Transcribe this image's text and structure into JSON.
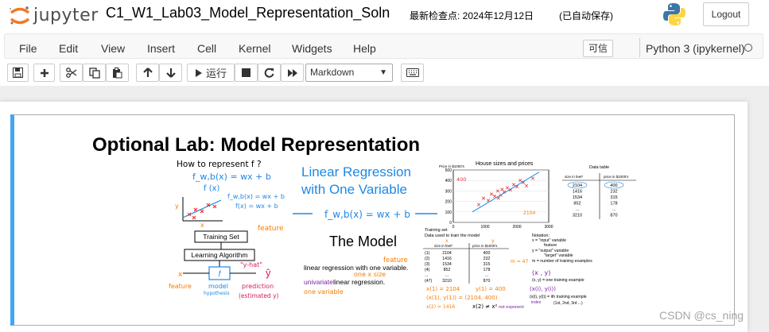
{
  "header": {
    "logo_text": "jupyter",
    "notebook_title": "C1_W1_Lab03_Model_Representation_Soln",
    "checkpoint": "最新检查点: 2024年12月12日",
    "autosave": "(已自动保存)",
    "logout_label": "Logout"
  },
  "menu": {
    "items": [
      "File",
      "Edit",
      "View",
      "Insert",
      "Cell",
      "Kernel",
      "Widgets",
      "Help"
    ],
    "trusted_label": "可信",
    "kernel_name": "Python 3 (ipykernel)"
  },
  "toolbar": {
    "run_label": "运行",
    "cell_type": "Markdown",
    "icons": [
      "save-icon",
      "plus-icon",
      "cut-icon",
      "copy-icon",
      "paste-icon",
      "arrow-up-icon",
      "arrow-down-icon",
      "play-icon",
      "stop-icon",
      "restart-icon",
      "fast-forward-icon",
      "keyboard-icon"
    ]
  },
  "cell": {
    "heading": "Optional Lab: Model Representation"
  },
  "figure": {
    "how_to_represent": "How to represent f ?",
    "f_eq1": "f_w,b(x) = wx + b",
    "f_of_x": "f (x)",
    "f_eq2": "f_w,b(x) = wx + b",
    "f_eq3": "f(x) = wx + b",
    "y_axis": "y",
    "x_axis": "x",
    "feature_label1": "feature",
    "training_set": "Training Set",
    "learning_algorithm": "Learning Algorithm",
    "f_box": "f",
    "y_hat_note": "\"y-hat\"",
    "y_hat": "ŷ",
    "x_in": "x",
    "feature_label2": "feature",
    "model_label": "model",
    "hypothesis_label": "hypothesis",
    "prediction_label": "prediction",
    "estimated_y": "(estimated y)",
    "lr_title_line1": "Linear Regression",
    "lr_title_line2": "with One Variable",
    "lr_eq": "f_w,b(x) = wx + b",
    "the_model": "The Model",
    "feature_note": "feature",
    "lr_desc_1": "linear regression with one variable.",
    "one_x_size": "one x  size",
    "univariate": "univariate",
    "univariate_rest": " linear regression.",
    "one_variable": "one variable",
    "chart_title": "House sizes and prices",
    "chart_ylabel": "Price in $1000's",
    "chart_yticks": [
      "500",
      "400",
      "300",
      "200",
      "100",
      "0"
    ],
    "chart_xticks": [
      "0",
      "1000",
      "2000",
      "3000"
    ],
    "chart_anno_400": "400",
    "chart_anno_2104": "2104",
    "data_table_title": "Data table",
    "dt_col1": "size in feet²",
    "dt_col2": "price in $1000's",
    "dt_sizes": [
      "2104",
      "1416",
      "1534",
      "852",
      "...",
      "3210"
    ],
    "dt_prices": [
      "400",
      "232",
      "315",
      "178",
      "...",
      "870"
    ],
    "ts_title": "Training set",
    "ts_subtitle": "Data used to train the model",
    "ts_x": "x",
    "ts_y": "y",
    "ts_col1": "size in feet²",
    "ts_col2": "price in $1000's",
    "ts_idx": [
      "(1)",
      "(2)",
      "(3)",
      "(4)",
      "...",
      "(47)"
    ],
    "ts_sizes": [
      "2104",
      "1416",
      "1534",
      "852",
      "...",
      "3210"
    ],
    "ts_prices": [
      "400",
      "232",
      "315",
      "178",
      "...",
      "870"
    ],
    "ts_m": "m = 47",
    "ts_x1": "x(1) = 2104",
    "ts_y1": "y(1) = 400",
    "ts_pair": "(x(1), y(1)) = (2104, 400)",
    "ts_x2": "x(2) = 1416",
    "ts_x2note": "x(2) ≠ x²",
    "ts_not_exponent": "not exponent",
    "notation_title": "Notation:",
    "notation_1": "x = \"input\" variable",
    "notation_1b": "feature",
    "notation_2": "y = \"output\" variable",
    "notation_2b": "\"target\" variable",
    "notation_3": "m = number of training examples",
    "notation_xy": "(x , y)",
    "notation_4": "(x, y) = one training example",
    "notation_xiyi": "(x(i), y(i))",
    "notation_5": "(x(i), y(i)) = ith training example",
    "notation_index": "index",
    "notation_6": "(1st, 2nd, 3rd ...)"
  },
  "watermark": "CSDN @cs_ning",
  "chart_data": {
    "type": "scatter",
    "title": "House sizes and prices",
    "ylabel": "Price in $1000's",
    "xlim": [
      0,
      3000
    ],
    "ylim": [
      0,
      500
    ],
    "x": [
      800,
      950,
      1100,
      1200,
      1300,
      1400,
      1416,
      1500,
      1534,
      1600,
      1700,
      1800,
      1900,
      2000,
      2104,
      2200,
      2300,
      2500
    ],
    "y": [
      170,
      230,
      210,
      270,
      250,
      300,
      232,
      260,
      315,
      290,
      330,
      310,
      360,
      340,
      400,
      380,
      350,
      420
    ],
    "fit_line": {
      "x": [
        600,
        2700
      ],
      "y": [
        100,
        480
      ]
    }
  }
}
